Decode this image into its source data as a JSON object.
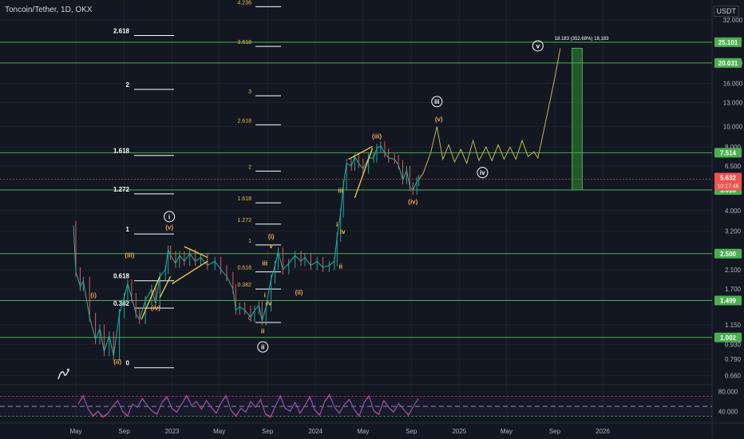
{
  "header": {
    "symbol": "Toncoin/Tether, 1D, OKX",
    "currency": "USDT"
  },
  "colors": {
    "bg": "#131722",
    "grid": "#1e222d",
    "hline": "#4caf50",
    "hlineLabel": "#4caf50",
    "yellow": "#e6c544",
    "orange": "#f0a44a",
    "white": "#ffffff",
    "candleUp": "#26a69a",
    "candleDown": "#ef5350",
    "pathLine": "#c2b652",
    "rsi": "#7e57c2",
    "rsiMA": "#f23645",
    "priceBox": "#ef5350",
    "target": "#2e7d32"
  },
  "chart_data": {
    "type": "line",
    "x_axis": {
      "labels": [
        "May",
        "Sep",
        "2023",
        "May",
        "Sep",
        "2024",
        "May",
        "Sep",
        "2025",
        "May",
        "Sep",
        "2026"
      ],
      "dates": [
        "2022-05-01",
        "2022-09-01",
        "2023-01-01",
        "2023-05-01",
        "2023-09-01",
        "2024-01-01",
        "2024-05-01",
        "2024-09-01",
        "2025-01-01",
        "2025-05-01",
        "2025-09-01",
        "2026-01-01"
      ]
    },
    "y_axis": {
      "scale": "log",
      "range": [
        0.56,
        40
      ],
      "ticks": [
        "32.000",
        "20.000",
        "16.000",
        "13.000",
        "10.000",
        "8.000",
        "6.500",
        "4.000",
        "3.200",
        "2.100",
        "1.700",
        "1.150",
        "0.930",
        "0.790",
        "0.660"
      ]
    },
    "price_series": {
      "name": "",
      "points": [
        [
          "2022-04-25",
          3.4
        ],
        [
          "2022-05-01",
          2.05
        ],
        [
          "2022-05-12",
          1.75
        ],
        [
          "2022-05-20",
          1.85
        ],
        [
          "2022-06-05",
          1.25
        ],
        [
          "2022-06-20",
          0.98
        ],
        [
          "2022-07-01",
          1.1
        ],
        [
          "2022-07-12",
          0.86
        ],
        [
          "2022-07-25",
          1.02
        ],
        [
          "2022-08-05",
          0.82
        ],
        [
          "2022-08-20",
          1.3
        ],
        [
          "2022-09-01",
          1.55
        ],
        [
          "2022-09-10",
          1.8
        ],
        [
          "2022-09-20",
          1.55
        ],
        [
          "2022-10-01",
          1.3
        ],
        [
          "2022-10-10",
          1.22
        ],
        [
          "2022-10-25",
          1.5
        ],
        [
          "2022-11-10",
          1.7
        ],
        [
          "2022-11-20",
          1.45
        ],
        [
          "2022-12-01",
          1.95
        ],
        [
          "2022-12-15",
          2.1
        ],
        [
          "2022-12-22",
          2.6
        ],
        [
          "2022-12-28",
          2.45
        ],
        [
          "2023-01-10",
          2.25
        ],
        [
          "2023-01-20",
          2.45
        ],
        [
          "2023-02-01",
          2.3
        ],
        [
          "2023-02-15",
          2.5
        ],
        [
          "2023-03-01",
          2.3
        ],
        [
          "2023-03-15",
          2.4
        ],
        [
          "2023-04-01",
          2.2
        ],
        [
          "2023-04-20",
          2.3
        ],
        [
          "2023-05-05",
          2.1
        ],
        [
          "2023-05-20",
          1.95
        ],
        [
          "2023-06-05",
          1.7
        ],
        [
          "2023-06-12",
          1.35
        ],
        [
          "2023-06-22",
          1.4
        ],
        [
          "2023-07-05",
          1.35
        ],
        [
          "2023-07-20",
          1.25
        ],
        [
          "2023-07-30",
          1.35
        ],
        [
          "2023-08-10",
          1.42
        ],
        [
          "2023-08-18",
          1.2
        ],
        [
          "2023-08-28",
          1.4
        ],
        [
          "2023-09-10",
          1.9
        ],
        [
          "2023-09-20",
          2.2
        ],
        [
          "2023-09-28",
          2.55
        ],
        [
          "2023-10-10",
          2.1
        ],
        [
          "2023-10-25",
          2.25
        ],
        [
          "2023-11-10",
          2.45
        ],
        [
          "2023-11-25",
          2.3
        ],
        [
          "2023-12-05",
          2.4
        ],
        [
          "2023-12-20",
          2.2
        ],
        [
          "2024-01-05",
          2.3
        ],
        [
          "2024-01-20",
          2.15
        ],
        [
          "2024-02-05",
          2.2
        ],
        [
          "2024-02-18",
          2.3
        ],
        [
          "2024-02-25",
          3.0
        ],
        [
          "2024-03-05",
          3.9
        ],
        [
          "2024-03-12",
          5.3
        ],
        [
          "2024-03-20",
          6.7
        ],
        [
          "2024-04-01",
          6.5
        ],
        [
          "2024-04-10",
          7.2
        ],
        [
          "2024-04-20",
          6.7
        ],
        [
          "2024-05-01",
          6.3
        ],
        [
          "2024-05-15",
          7.1
        ],
        [
          "2024-05-28",
          7.1
        ],
        [
          "2024-06-05",
          7.9
        ],
        [
          "2024-06-15",
          8.1
        ],
        [
          "2024-06-25",
          7.5
        ],
        [
          "2024-07-05",
          7.1
        ],
        [
          "2024-07-20",
          7.0
        ],
        [
          "2024-07-30",
          6.6
        ],
        [
          "2024-08-10",
          5.6
        ],
        [
          "2024-08-20",
          6.2
        ],
        [
          "2024-08-28",
          5.2
        ],
        [
          "2024-09-05",
          5.0
        ],
        [
          "2024-09-15",
          5.5
        ],
        [
          "2024-09-20",
          5.63
        ]
      ]
    },
    "projection_path": [
      [
        "2024-09-20",
        5.63
      ],
      [
        "2024-10-01",
        6.0
      ],
      [
        "2024-10-20",
        7.5
      ],
      [
        "2024-11-05",
        10.0
      ],
      [
        "2024-11-20",
        7.0
      ],
      [
        "2024-12-05",
        8.2
      ],
      [
        "2024-12-20",
        6.8
      ],
      [
        "2025-01-05",
        7.8
      ],
      [
        "2025-01-20",
        6.7
      ],
      [
        "2025-02-05",
        8.6
      ],
      [
        "2025-02-20",
        6.9
      ],
      [
        "2025-03-10",
        8.0
      ],
      [
        "2025-03-25",
        6.9
      ],
      [
        "2025-04-10",
        8.2
      ],
      [
        "2025-04-25",
        7.0
      ],
      [
        "2025-05-10",
        8.0
      ],
      [
        "2025-05-25",
        7.0
      ],
      [
        "2025-06-10",
        8.6
      ],
      [
        "2025-06-25",
        7.2
      ],
      [
        "2025-07-10",
        7.6
      ],
      [
        "2025-07-20",
        7.1
      ],
      [
        "2025-08-01",
        9.0
      ],
      [
        "2025-08-15",
        12.0
      ],
      [
        "2025-09-01",
        17.0
      ],
      [
        "2025-09-15",
        23.5
      ]
    ],
    "horizontal_levels": [
      {
        "price": 25.101,
        "label": "25.101"
      },
      {
        "price": 20.031,
        "label": "20.031"
      },
      {
        "price": 7.514,
        "label": "7.514"
      },
      {
        "price": 5.01,
        "label": "5.010"
      },
      {
        "price": 2.5,
        "label": "2.500"
      },
      {
        "price": 1.499,
        "label": "1.499"
      },
      {
        "price": 1.002,
        "label": "1.002"
      }
    ],
    "current_price": {
      "price": 5.632,
      "label": "5.632",
      "countdown": "10:17:46"
    },
    "target_box": {
      "from_date": "2025-10-15",
      "to_date": "2025-11-10",
      "from_price": 5.01,
      "to_price": 23.5,
      "label": "18.183 (352.68%) 18,183"
    },
    "fib_left": [
      {
        "label": "2.618",
        "price": 27.0
      },
      {
        "label": "2",
        "price": 15.0
      },
      {
        "label": "1.618",
        "price": 7.3
      },
      {
        "label": "1.272",
        "price": 4.8
      },
      {
        "label": "1",
        "price": 3.1
      },
      {
        "label": "0.618",
        "price": 1.86
      },
      {
        "label": "0.382",
        "price": 1.38
      },
      {
        "label": "0",
        "price": 0.72
      }
    ],
    "fib_mid": [
      {
        "label": "4.236",
        "price": 37.0
      },
      {
        "label": "3.618",
        "price": 24.0
      },
      {
        "label": "3",
        "price": 14.0
      },
      {
        "label": "2.618",
        "price": 10.2
      },
      {
        "label": "2",
        "price": 6.15
      },
      {
        "label": "1.618",
        "price": 4.35
      },
      {
        "label": "1.272",
        "price": 3.45
      },
      {
        "label": "1",
        "price": 2.75
      },
      {
        "label": "0.618",
        "price": 2.05
      },
      {
        "label": "0.382",
        "price": 1.7
      },
      {
        "label": "0",
        "price": 1.18
      }
    ],
    "wave_labels": [
      {
        "text": "(i)",
        "date": "2022-06-15",
        "price": 1.55,
        "color": "orange"
      },
      {
        "text": "(ii)",
        "date": "2022-08-15",
        "price": 0.75,
        "color": "orange"
      },
      {
        "text": "(iii)",
        "date": "2022-09-15",
        "price": 2.4,
        "color": "orange"
      },
      {
        "text": "(iv)",
        "date": "2022-11-20",
        "price": 1.35,
        "color": "orange"
      },
      {
        "text": "(v)",
        "date": "2022-12-25",
        "price": 3.25,
        "color": "orange"
      },
      {
        "text": "i",
        "date": "2022-12-25",
        "price": 3.65,
        "color": "white",
        "circled": true
      },
      {
        "text": "(i)",
        "date": "2023-09-10",
        "price": 2.95,
        "color": "orange"
      },
      {
        "text": "(ii)",
        "date": "2023-11-20",
        "price": 1.6,
        "color": "orange"
      },
      {
        "text": "v",
        "date": "2023-09-10",
        "price": 2.65,
        "color": "yellow"
      },
      {
        "text": "iii",
        "date": "2023-08-25",
        "price": 2.2,
        "color": "yellow"
      },
      {
        "text": "i",
        "date": "2023-08-25",
        "price": 1.55,
        "color": "yellow"
      },
      {
        "text": "iv",
        "date": "2023-09-05",
        "price": 1.42,
        "color": "yellow"
      },
      {
        "text": "ii",
        "date": "2023-08-20",
        "price": 1.05,
        "color": "yellow"
      },
      {
        "text": "ii",
        "date": "2023-08-20",
        "price": 0.88,
        "color": "white",
        "circled": true
      },
      {
        "text": "i",
        "date": "2024-02-25",
        "price": 3.35,
        "color": "yellow"
      },
      {
        "text": "ii",
        "date": "2024-03-05",
        "price": 2.12,
        "color": "yellow"
      },
      {
        "text": "iv",
        "date": "2024-03-10",
        "price": 3.1,
        "color": "yellow"
      },
      {
        "text": "iii",
        "date": "2024-03-05",
        "price": 4.85,
        "color": "yellow"
      },
      {
        "text": "(iii)",
        "date": "2024-06-05",
        "price": 8.8,
        "color": "orange"
      },
      {
        "text": "(iv)",
        "date": "2024-09-05",
        "price": 4.3,
        "color": "orange"
      },
      {
        "text": "(v)",
        "date": "2024-11-10",
        "price": 10.6,
        "color": "orange"
      },
      {
        "text": "iii",
        "date": "2024-11-05",
        "price": 12.8,
        "color": "white",
        "circled": true
      },
      {
        "text": "iv",
        "date": "2025-03-01",
        "price": 5.9,
        "color": "white",
        "circled": true
      },
      {
        "text": "v",
        "date": "2025-07-20",
        "price": 23.5,
        "color": "white",
        "circled": true
      }
    ],
    "trend_segments": [
      {
        "from": [
          "2022-10-15",
          1.22
        ],
        "to": [
          "2022-12-01",
          1.95
        ]
      },
      {
        "from": [
          "2022-12-01",
          1.55
        ],
        "to": [
          "2022-12-28",
          1.95
        ]
      },
      {
        "from": [
          "2023-01-01",
          1.8
        ],
        "to": [
          "2023-04-01",
          2.3
        ]
      },
      {
        "from": [
          "2023-02-01",
          2.7
        ],
        "to": [
          "2023-04-01",
          2.4
        ]
      },
      {
        "from": [
          "2024-03-25",
          7.0
        ],
        "to": [
          "2024-05-25",
          8.05
        ]
      },
      {
        "from": [
          "2024-04-10",
          4.6
        ],
        "to": [
          "2024-05-25",
          7.9
        ]
      }
    ],
    "rsi": {
      "name": "",
      "ticks": [
        "80.000",
        "40.000"
      ],
      "upper": 70,
      "mid": 50,
      "lower": 30,
      "values": [
        55,
        72,
        45,
        30,
        40,
        28,
        35,
        50,
        62,
        40,
        30,
        55,
        48,
        66,
        52,
        40,
        34,
        58,
        70,
        46,
        38,
        55,
        72,
        52,
        60,
        44,
        62,
        48,
        36,
        58,
        72,
        42,
        30,
        46,
        38,
        60,
        48,
        64,
        34,
        28,
        50,
        72,
        46,
        40,
        58,
        36,
        52,
        70,
        42,
        32,
        60,
        74,
        48,
        36,
        54,
        64,
        44,
        30,
        58,
        72,
        40,
        34,
        62,
        48,
        38,
        56,
        44,
        32,
        50,
        66
      ]
    }
  }
}
